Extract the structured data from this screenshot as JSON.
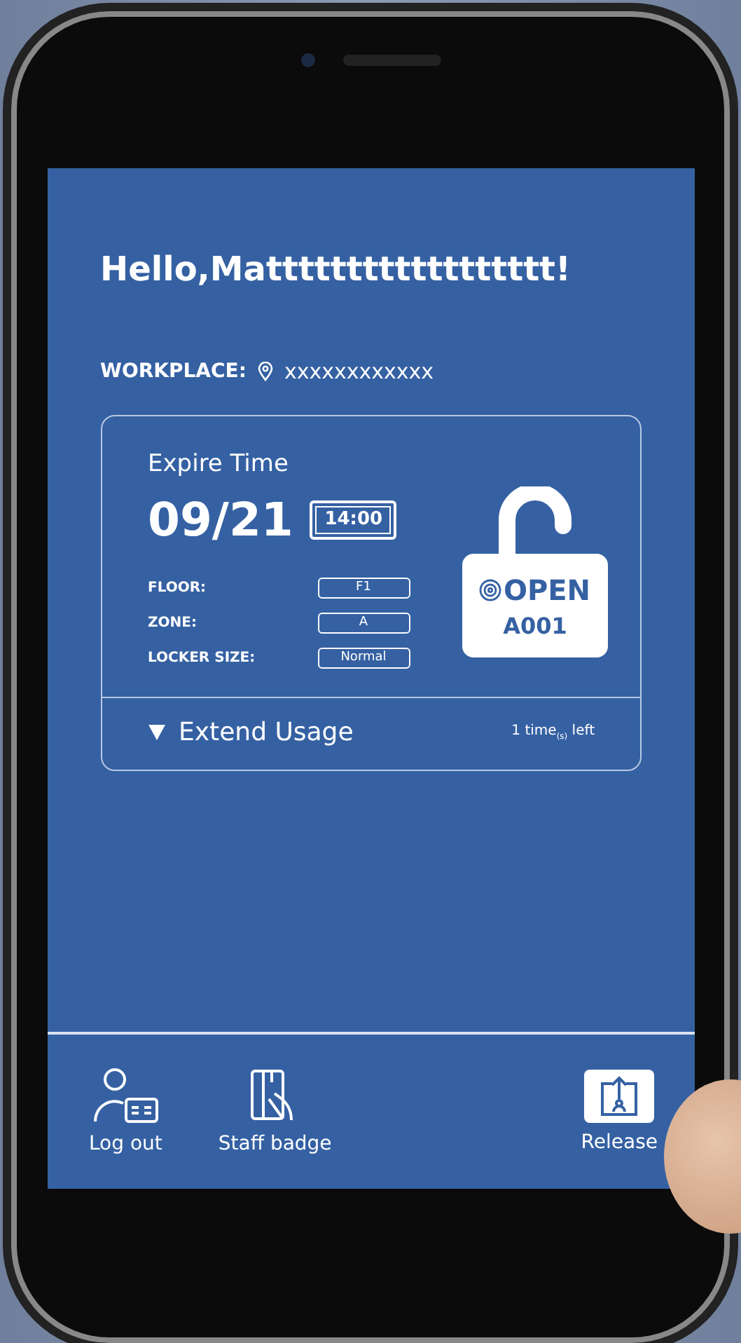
{
  "greeting": "Hello,Matttttttttttttttttt!",
  "workplace": {
    "label": "WORKPLACE:",
    "value": "xxxxxxxxxxxx"
  },
  "card": {
    "title": "Expire Time",
    "date": "09/21",
    "time": "14:00",
    "fields": [
      {
        "label": "FLOOR:",
        "value": "F1"
      },
      {
        "label": "ZONE:",
        "value": "A"
      },
      {
        "label": "LOCKER SIZE:",
        "value": "Normal"
      }
    ],
    "lock": {
      "status": "OPEN",
      "locker": "A001"
    },
    "extend": {
      "label": "Extend Usage",
      "expanded": false,
      "remaining": "1 time$_{(s)}$ left"
    }
  },
  "nav": [
    {
      "kind": "logout",
      "label": "Log out",
      "selected": false
    },
    {
      "kind": "badge",
      "label": "Staff badge",
      "selected": false
    },
    {
      "kind": "release",
      "label": "Release",
      "selected": true
    }
  ]
}
